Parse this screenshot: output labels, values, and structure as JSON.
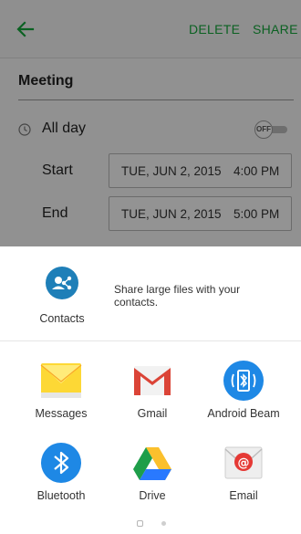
{
  "appbar": {
    "delete_label": "DELETE",
    "share_label": "SHARE",
    "accent_color": "#14a83b"
  },
  "event": {
    "title": "Meeting",
    "all_day_label": "All day",
    "all_day_toggle": "OFF",
    "start": {
      "label": "Start",
      "date": "TUE, JUN 2, 2015",
      "time": "4:00 PM"
    },
    "end": {
      "label": "End",
      "date": "TUE, JUN 2, 2015",
      "time": "5:00 PM"
    }
  },
  "share_sheet": {
    "direct_share": {
      "label": "Contacts",
      "description": "Share large files with your contacts.",
      "icon": "contacts-share-icon"
    },
    "apps": [
      {
        "label": "Messages",
        "icon": "messages-icon"
      },
      {
        "label": "Gmail",
        "icon": "gmail-icon"
      },
      {
        "label": "Android Beam",
        "icon": "android-beam-icon"
      },
      {
        "label": "Bluetooth",
        "icon": "bluetooth-icon"
      },
      {
        "label": "Drive",
        "icon": "drive-icon"
      },
      {
        "label": "Email",
        "icon": "email-icon"
      }
    ],
    "page_count": 2,
    "current_page": 1
  }
}
